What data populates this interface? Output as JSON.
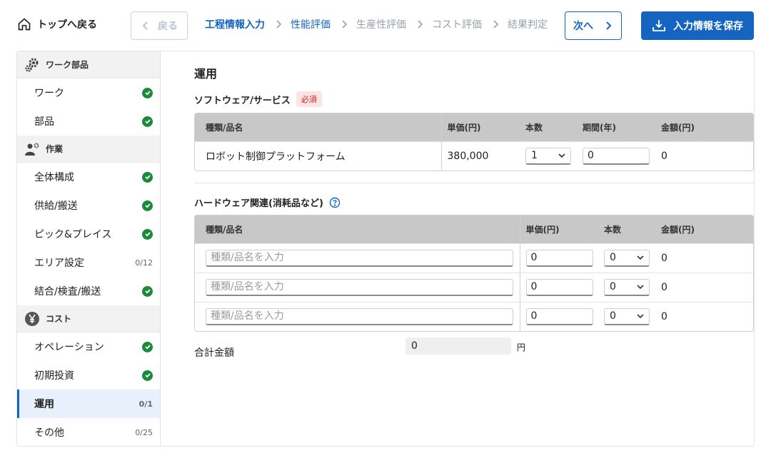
{
  "header": {
    "home_label": "トップへ戻る",
    "back_label": "戻る",
    "next_label": "次へ",
    "save_label": "入力情報を保存",
    "steps": [
      {
        "label": "工程情報入力",
        "state": "done"
      },
      {
        "label": "性能評価",
        "state": "current"
      },
      {
        "label": "生産性評価",
        "state": "todo"
      },
      {
        "label": "コスト評価",
        "state": "todo"
      },
      {
        "label": "結果判定",
        "state": "todo"
      }
    ]
  },
  "sidebar": {
    "groups": [
      {
        "label": "ワーク部品",
        "icon": "gears-icon",
        "items": [
          {
            "label": "ワーク",
            "status": "complete"
          },
          {
            "label": "部品",
            "status": "complete"
          }
        ]
      },
      {
        "label": "作業",
        "icon": "worker-icon",
        "items": [
          {
            "label": "全体構成",
            "status": "complete"
          },
          {
            "label": "供給/搬送",
            "status": "complete"
          },
          {
            "label": "ピック&プレイス",
            "status": "complete"
          },
          {
            "label": "エリア設定",
            "status": "0/12"
          },
          {
            "label": "結合/検査/搬送",
            "status": "complete"
          }
        ]
      },
      {
        "label": "コスト",
        "icon": "yen-icon",
        "items": [
          {
            "label": "オペレーション",
            "status": "complete"
          },
          {
            "label": "初期投資",
            "status": "complete"
          },
          {
            "label": "運用",
            "status": "0/1",
            "active": true
          },
          {
            "label": "その他",
            "status": "0/25"
          }
        ]
      }
    ]
  },
  "main": {
    "title": "運用",
    "software": {
      "label": "ソフトウェア/サービス",
      "required": "必須",
      "headers": [
        "種類/品名",
        "単価(円)",
        "本数",
        "期間(年)",
        "金額(円)"
      ],
      "rows": [
        {
          "name": "ロボット制御プラットフォーム",
          "price": "380,000",
          "qty": "1",
          "period": "0",
          "amount": "0"
        }
      ]
    },
    "hardware": {
      "label": "ハードウェア関連(消耗品など)",
      "headers": [
        "種類/品名",
        "単価(円)",
        "本数",
        "金額(円)"
      ],
      "placeholder": "種類/品名を入力",
      "rows": [
        {
          "price": "0",
          "qty": "0",
          "amount": "0"
        },
        {
          "price": "0",
          "qty": "0",
          "amount": "0"
        },
        {
          "price": "0",
          "qty": "0",
          "amount": "0"
        }
      ]
    },
    "total": {
      "label": "合計金額",
      "value": "0",
      "unit": "円"
    }
  },
  "colors": {
    "accent": "#1565c0",
    "complete": "#1b8a3a",
    "required_bg": "#fde3e3",
    "required_fg": "#c62828"
  }
}
